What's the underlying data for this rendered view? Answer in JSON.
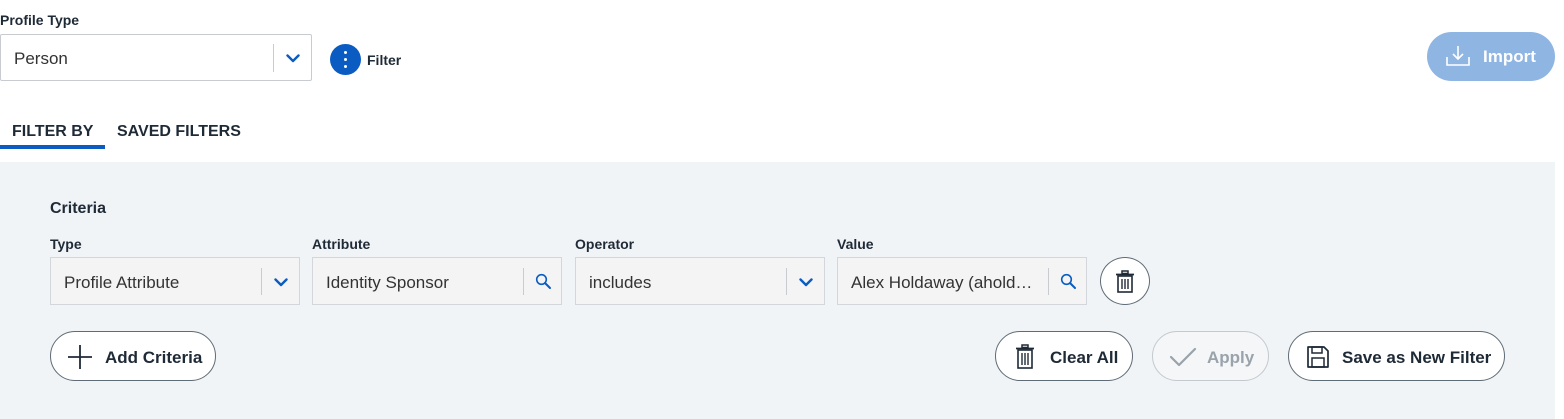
{
  "profile_type": {
    "label": "Profile Type",
    "value": "Person"
  },
  "filter": {
    "label": "Filter"
  },
  "import": {
    "label": "Import"
  },
  "tabs": [
    {
      "label": "FILTER BY",
      "active": true
    },
    {
      "label": "SAVED FILTERS",
      "active": false
    }
  ],
  "criteria": {
    "title": "Criteria",
    "type": {
      "label": "Type",
      "value": "Profile Attribute"
    },
    "attribute": {
      "label": "Attribute",
      "value": "Identity Sponsor"
    },
    "operator": {
      "label": "Operator",
      "value": "includes"
    },
    "value": {
      "label": "Value",
      "value": "Alex Holdaway (ahold…"
    }
  },
  "actions": {
    "add_criteria": "Add Criteria",
    "clear_all": "Clear All",
    "apply": "Apply",
    "save_as_new_filter": "Save as New Filter"
  },
  "colors": {
    "accent": "#0a5cc2",
    "import_disabled": "#8fb5e3",
    "panel_bg": "#f1f4f6"
  },
  "icons": [
    "chevron-down-icon",
    "more-vertical-icon",
    "import-icon",
    "search-icon",
    "trash-icon",
    "plus-icon",
    "check-icon",
    "save-icon"
  ]
}
